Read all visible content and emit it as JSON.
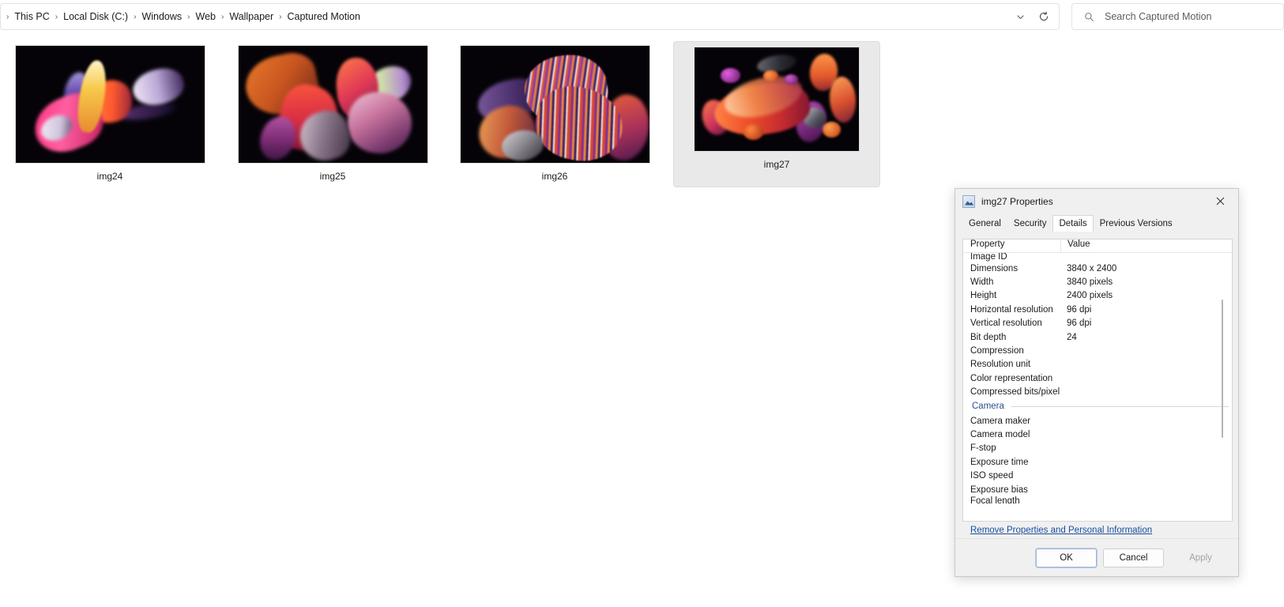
{
  "explorer": {
    "breadcrumb": {
      "leading_separator": "›",
      "separator": "›",
      "crumbs": [
        "This PC",
        "Local Disk (C:)",
        "Windows",
        "Web",
        "Wallpaper",
        "Captured Motion"
      ]
    },
    "address_chevron_icon": "chevron-down-icon",
    "refresh_icon": "refresh-icon",
    "search": {
      "icon": "search-icon",
      "placeholder": "Search Captured Motion",
      "value": ""
    },
    "files": [
      {
        "label": "img24",
        "selected": false
      },
      {
        "label": "img25",
        "selected": false
      },
      {
        "label": "img26",
        "selected": false
      },
      {
        "label": "img27",
        "selected": true
      }
    ]
  },
  "dialog": {
    "title": "img27 Properties",
    "icon": "image-file-icon",
    "close_icon": "close-icon",
    "tabs": [
      {
        "label": "General",
        "active": false
      },
      {
        "label": "Security",
        "active": false
      },
      {
        "label": "Details",
        "active": true
      },
      {
        "label": "Previous Versions",
        "active": false
      }
    ],
    "columns": {
      "property": "Property",
      "value": "Value"
    },
    "rows": [
      {
        "name": "Image ID",
        "value": "",
        "kind": "clipped-top"
      },
      {
        "name": "Dimensions",
        "value": "3840 x 2400",
        "kind": "row"
      },
      {
        "name": "Width",
        "value": "3840 pixels",
        "kind": "row"
      },
      {
        "name": "Height",
        "value": "2400 pixels",
        "kind": "row"
      },
      {
        "name": "Horizontal resolution",
        "value": "96 dpi",
        "kind": "row"
      },
      {
        "name": "Vertical resolution",
        "value": "96 dpi",
        "kind": "row"
      },
      {
        "name": "Bit depth",
        "value": "24",
        "kind": "row"
      },
      {
        "name": "Compression",
        "value": "",
        "kind": "row"
      },
      {
        "name": "Resolution unit",
        "value": "",
        "kind": "row"
      },
      {
        "name": "Color representation",
        "value": "",
        "kind": "row"
      },
      {
        "name": "Compressed bits/pixel",
        "value": "",
        "kind": "row"
      },
      {
        "name": "Camera",
        "value": "",
        "kind": "section"
      },
      {
        "name": "Camera maker",
        "value": "",
        "kind": "row"
      },
      {
        "name": "Camera model",
        "value": "",
        "kind": "row"
      },
      {
        "name": "F-stop",
        "value": "",
        "kind": "row"
      },
      {
        "name": "Exposure time",
        "value": "",
        "kind": "row"
      },
      {
        "name": "ISO speed",
        "value": "",
        "kind": "row"
      },
      {
        "name": "Exposure bias",
        "value": "",
        "kind": "row"
      },
      {
        "name": "Focal length",
        "value": "",
        "kind": "clipped-bottom"
      }
    ],
    "remove_link": "Remove Properties and Personal Information",
    "buttons": {
      "ok": "OK",
      "cancel": "Cancel",
      "apply": "Apply"
    }
  },
  "colors": {
    "accent_link": "#1a4fa0",
    "section_header": "#2a4f8f",
    "selection_bg": "#e9e9e9",
    "default_button_ring": "#b9cde6"
  }
}
